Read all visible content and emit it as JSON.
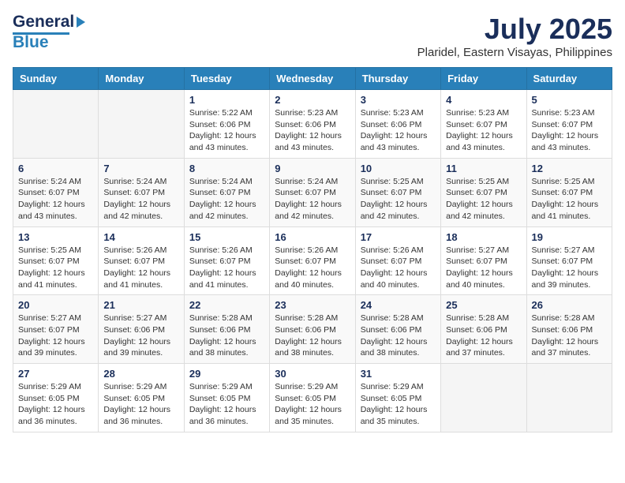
{
  "header": {
    "logo": {
      "general": "General",
      "blue": "Blue"
    },
    "title": "July 2025",
    "location": "Plaridel, Eastern Visayas, Philippines"
  },
  "calendar": {
    "headers": [
      "Sunday",
      "Monday",
      "Tuesday",
      "Wednesday",
      "Thursday",
      "Friday",
      "Saturday"
    ],
    "weeks": [
      [
        {
          "day": "",
          "info": ""
        },
        {
          "day": "",
          "info": ""
        },
        {
          "day": "1",
          "info": "Sunrise: 5:22 AM\nSunset: 6:06 PM\nDaylight: 12 hours and 43 minutes."
        },
        {
          "day": "2",
          "info": "Sunrise: 5:23 AM\nSunset: 6:06 PM\nDaylight: 12 hours and 43 minutes."
        },
        {
          "day": "3",
          "info": "Sunrise: 5:23 AM\nSunset: 6:06 PM\nDaylight: 12 hours and 43 minutes."
        },
        {
          "day": "4",
          "info": "Sunrise: 5:23 AM\nSunset: 6:07 PM\nDaylight: 12 hours and 43 minutes."
        },
        {
          "day": "5",
          "info": "Sunrise: 5:23 AM\nSunset: 6:07 PM\nDaylight: 12 hours and 43 minutes."
        }
      ],
      [
        {
          "day": "6",
          "info": "Sunrise: 5:24 AM\nSunset: 6:07 PM\nDaylight: 12 hours and 43 minutes."
        },
        {
          "day": "7",
          "info": "Sunrise: 5:24 AM\nSunset: 6:07 PM\nDaylight: 12 hours and 42 minutes."
        },
        {
          "day": "8",
          "info": "Sunrise: 5:24 AM\nSunset: 6:07 PM\nDaylight: 12 hours and 42 minutes."
        },
        {
          "day": "9",
          "info": "Sunrise: 5:24 AM\nSunset: 6:07 PM\nDaylight: 12 hours and 42 minutes."
        },
        {
          "day": "10",
          "info": "Sunrise: 5:25 AM\nSunset: 6:07 PM\nDaylight: 12 hours and 42 minutes."
        },
        {
          "day": "11",
          "info": "Sunrise: 5:25 AM\nSunset: 6:07 PM\nDaylight: 12 hours and 42 minutes."
        },
        {
          "day": "12",
          "info": "Sunrise: 5:25 AM\nSunset: 6:07 PM\nDaylight: 12 hours and 41 minutes."
        }
      ],
      [
        {
          "day": "13",
          "info": "Sunrise: 5:25 AM\nSunset: 6:07 PM\nDaylight: 12 hours and 41 minutes."
        },
        {
          "day": "14",
          "info": "Sunrise: 5:26 AM\nSunset: 6:07 PM\nDaylight: 12 hours and 41 minutes."
        },
        {
          "day": "15",
          "info": "Sunrise: 5:26 AM\nSunset: 6:07 PM\nDaylight: 12 hours and 41 minutes."
        },
        {
          "day": "16",
          "info": "Sunrise: 5:26 AM\nSunset: 6:07 PM\nDaylight: 12 hours and 40 minutes."
        },
        {
          "day": "17",
          "info": "Sunrise: 5:26 AM\nSunset: 6:07 PM\nDaylight: 12 hours and 40 minutes."
        },
        {
          "day": "18",
          "info": "Sunrise: 5:27 AM\nSunset: 6:07 PM\nDaylight: 12 hours and 40 minutes."
        },
        {
          "day": "19",
          "info": "Sunrise: 5:27 AM\nSunset: 6:07 PM\nDaylight: 12 hours and 39 minutes."
        }
      ],
      [
        {
          "day": "20",
          "info": "Sunrise: 5:27 AM\nSunset: 6:07 PM\nDaylight: 12 hours and 39 minutes."
        },
        {
          "day": "21",
          "info": "Sunrise: 5:27 AM\nSunset: 6:06 PM\nDaylight: 12 hours and 39 minutes."
        },
        {
          "day": "22",
          "info": "Sunrise: 5:28 AM\nSunset: 6:06 PM\nDaylight: 12 hours and 38 minutes."
        },
        {
          "day": "23",
          "info": "Sunrise: 5:28 AM\nSunset: 6:06 PM\nDaylight: 12 hours and 38 minutes."
        },
        {
          "day": "24",
          "info": "Sunrise: 5:28 AM\nSunset: 6:06 PM\nDaylight: 12 hours and 38 minutes."
        },
        {
          "day": "25",
          "info": "Sunrise: 5:28 AM\nSunset: 6:06 PM\nDaylight: 12 hours and 37 minutes."
        },
        {
          "day": "26",
          "info": "Sunrise: 5:28 AM\nSunset: 6:06 PM\nDaylight: 12 hours and 37 minutes."
        }
      ],
      [
        {
          "day": "27",
          "info": "Sunrise: 5:29 AM\nSunset: 6:05 PM\nDaylight: 12 hours and 36 minutes."
        },
        {
          "day": "28",
          "info": "Sunrise: 5:29 AM\nSunset: 6:05 PM\nDaylight: 12 hours and 36 minutes."
        },
        {
          "day": "29",
          "info": "Sunrise: 5:29 AM\nSunset: 6:05 PM\nDaylight: 12 hours and 36 minutes."
        },
        {
          "day": "30",
          "info": "Sunrise: 5:29 AM\nSunset: 6:05 PM\nDaylight: 12 hours and 35 minutes."
        },
        {
          "day": "31",
          "info": "Sunrise: 5:29 AM\nSunset: 6:05 PM\nDaylight: 12 hours and 35 minutes."
        },
        {
          "day": "",
          "info": ""
        },
        {
          "day": "",
          "info": ""
        }
      ]
    ]
  }
}
